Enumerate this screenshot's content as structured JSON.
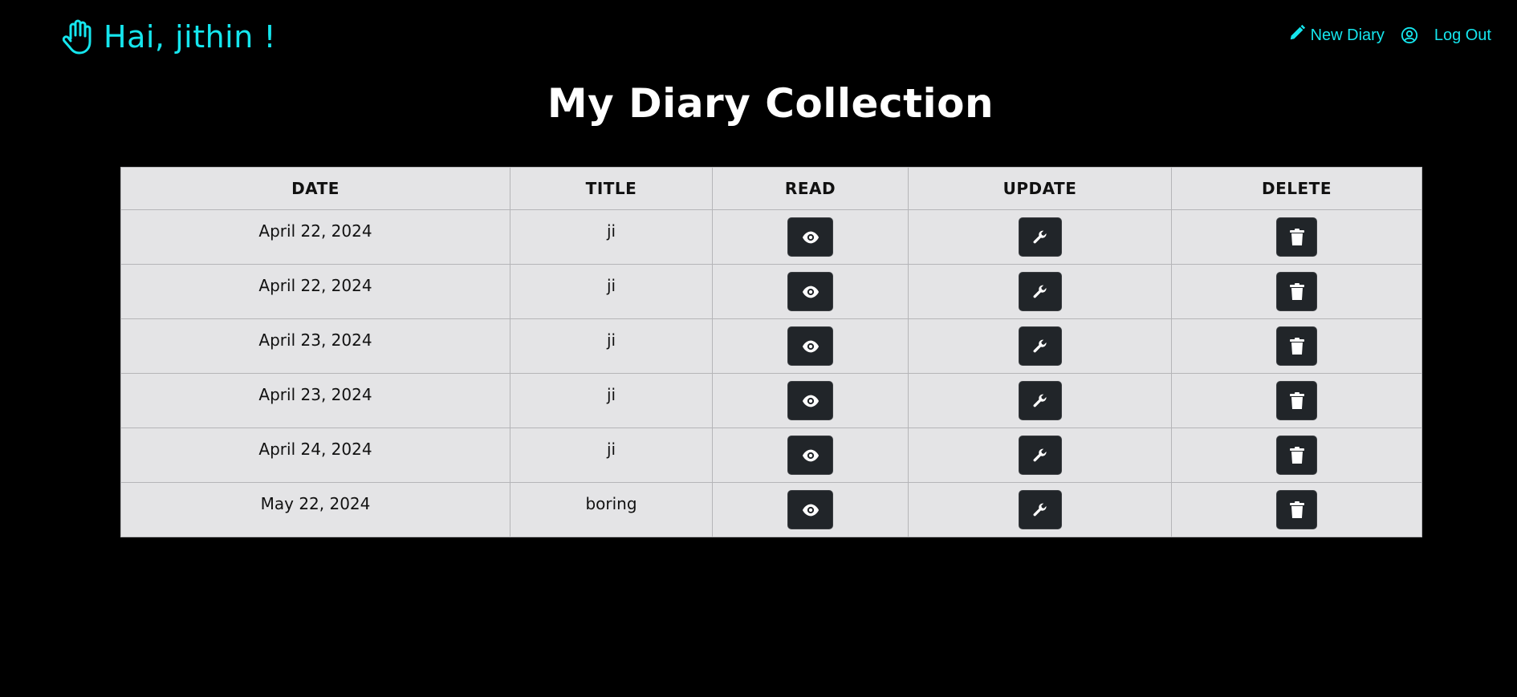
{
  "header": {
    "greeting": "Hai, jithin !",
    "new_diary_label": "New Diary",
    "logout_label": "Log Out"
  },
  "page_title": "My Diary Collection",
  "table": {
    "columns": [
      "DATE",
      "TITLE",
      "READ",
      "UPDATE",
      "DELETE"
    ],
    "rows": [
      {
        "date": "April 22, 2024",
        "title": "ji"
      },
      {
        "date": "April 22, 2024",
        "title": "ji"
      },
      {
        "date": "April 23, 2024",
        "title": "ji"
      },
      {
        "date": "April 23, 2024",
        "title": "ji"
      },
      {
        "date": "April 24, 2024",
        "title": "ji"
      },
      {
        "date": "May 22, 2024",
        "title": "boring"
      }
    ]
  },
  "icons": {
    "greeting": "hand-icon",
    "new_diary": "pencil-icon",
    "user": "user-circle-icon",
    "read": "eye-icon",
    "update": "wrench-icon",
    "delete": "trash-icon"
  },
  "colors": {
    "background": "#000000",
    "accent": "#15e6ee",
    "table_bg": "#e4e4e6",
    "button_bg": "#212529"
  }
}
